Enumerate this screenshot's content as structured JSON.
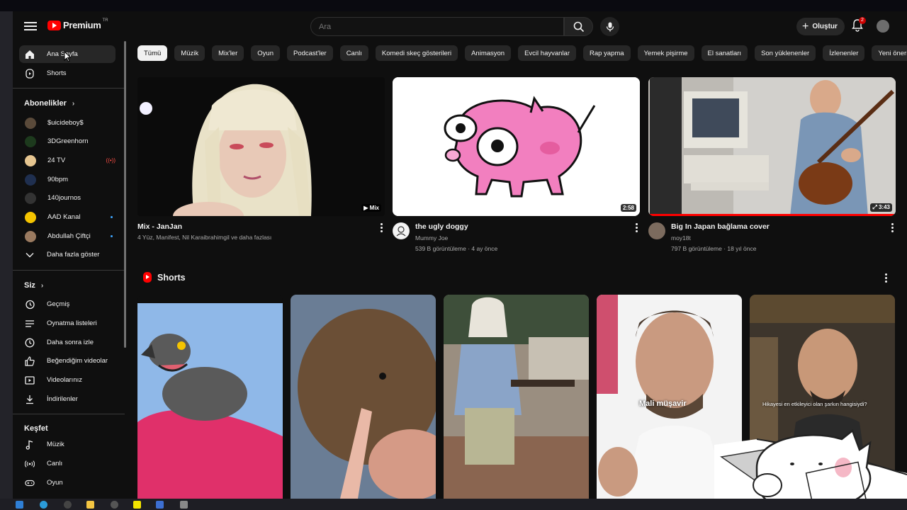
{
  "header": {
    "logo_text": "Premium",
    "logo_tm": "TR",
    "search_placeholder": "Ara",
    "create_label": "Oluştur",
    "notification_count": "2"
  },
  "sidebar": {
    "main": [
      {
        "label": "Ana Sayfa",
        "icon": "home-icon"
      },
      {
        "label": "Shorts",
        "icon": "shorts-icon"
      }
    ],
    "subs_title": "Abonelikler",
    "subscriptions": [
      {
        "label": "$uicideboy$",
        "color": "#5a4a3a"
      },
      {
        "label": "3DGreenhorn",
        "color": "#1d3a1d"
      },
      {
        "label": "24 TV",
        "color": "#e6c590"
      },
      {
        "label": "90bpm",
        "color": "#1f2f4f"
      },
      {
        "label": "140journos",
        "color": "#333333"
      },
      {
        "label": "AAD Kanal",
        "color": "#f5c400"
      },
      {
        "label": "Abdullah Çiftçi",
        "color": "#9a7a60"
      }
    ],
    "show_more": "Daha fazla göster",
    "you_title": "Siz",
    "you": [
      {
        "label": "Geçmiş",
        "icon": "history-icon"
      },
      {
        "label": "Oynatma listeleri",
        "icon": "playlist-icon"
      },
      {
        "label": "Daha sonra izle",
        "icon": "clock-icon"
      },
      {
        "label": "Beğendiğim videolar",
        "icon": "thumbs-up-icon"
      },
      {
        "label": "Videolarınız",
        "icon": "your-videos-icon"
      },
      {
        "label": "İndirilenler",
        "icon": "download-icon"
      }
    ],
    "explore_title": "Keşfet",
    "explore": [
      {
        "label": "Müzik",
        "icon": "music-icon"
      },
      {
        "label": "Canlı",
        "icon": "live-icon"
      },
      {
        "label": "Oyun",
        "icon": "gaming-icon"
      }
    ]
  },
  "chips": [
    "Tümü",
    "Müzik",
    "Mix'ler",
    "Oyun",
    "Podcast'ler",
    "Canlı",
    "Komedi skeç gösterileri",
    "Animasyon",
    "Evcil hayvanlar",
    "Rap yapma",
    "Yemek pişirme",
    "El sanatları",
    "Son yüklenenler",
    "İzlenenler",
    "Yeni öneriler"
  ],
  "videos": [
    {
      "title": "Mix - JanJan",
      "meta1": "4 Yüz, Manifest, Nil Karaibrahimgil ve daha fazlası",
      "badge": "Mix"
    },
    {
      "title": "the ugly doggy",
      "channel": "Mummy Joe",
      "stats": "539 B görüntüleme · 4 ay önce",
      "duration": "2:58"
    },
    {
      "title": "Big In Japan bağlama cover",
      "channel": "moy18t",
      "stats": "797 B görüntüleme · 18 yıl önce",
      "duration": "3:43"
    }
  ],
  "shorts": {
    "title": "Shorts",
    "items": [
      {
        "overlay": ""
      },
      {
        "overlay": ""
      },
      {
        "overlay": ""
      },
      {
        "overlay": "Mali müşavir"
      },
      {
        "overlay": "Hikayesi en etkileyici olan şarkın hangisiydi?"
      }
    ]
  },
  "colors": {
    "accent": "#ff0000",
    "bg": "#0f0f0f",
    "chip": "#272727"
  }
}
